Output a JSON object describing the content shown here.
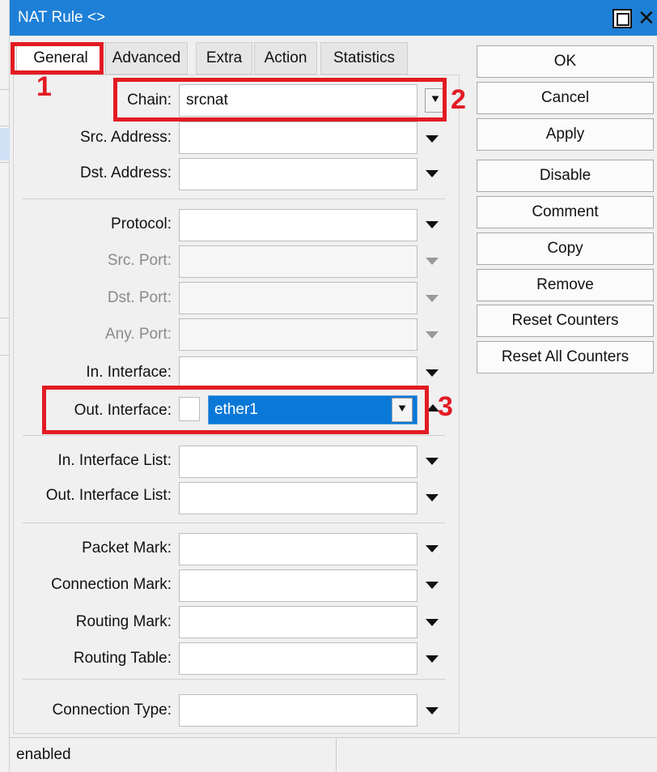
{
  "window": {
    "title": "NAT Rule <>",
    "close_glyph": "✕"
  },
  "tabs": [
    "General",
    "Advanced",
    "Extra",
    "Action",
    "Statistics"
  ],
  "fields": {
    "chain": {
      "label": "Chain:",
      "value": "srcnat"
    },
    "src_address": {
      "label": "Src. Address:"
    },
    "dst_address": {
      "label": "Dst. Address:"
    },
    "protocol": {
      "label": "Protocol:"
    },
    "src_port": {
      "label": "Src. Port:"
    },
    "dst_port": {
      "label": "Dst. Port:"
    },
    "any_port": {
      "label": "Any. Port:"
    },
    "in_interface": {
      "label": "In. Interface:"
    },
    "out_interface": {
      "label": "Out. Interface:",
      "value": "ether1"
    },
    "in_interface_list": {
      "label": "In. Interface List:"
    },
    "out_interface_list": {
      "label": "Out. Interface List:"
    },
    "packet_mark": {
      "label": "Packet Mark:"
    },
    "connection_mark": {
      "label": "Connection Mark:"
    },
    "routing_mark": {
      "label": "Routing Mark:"
    },
    "routing_table": {
      "label": "Routing Table:"
    },
    "connection_type": {
      "label": "Connection Type:"
    }
  },
  "buttons": [
    "OK",
    "Cancel",
    "Apply",
    "Disable",
    "Comment",
    "Copy",
    "Remove",
    "Reset Counters",
    "Reset All Counters"
  ],
  "status": {
    "text": "enabled"
  },
  "annotations": [
    "1",
    "2",
    "3"
  ],
  "colors": {
    "titlebar": "#1e7fd6",
    "selection": "#0a78d7",
    "annotation": "#e21b23"
  }
}
